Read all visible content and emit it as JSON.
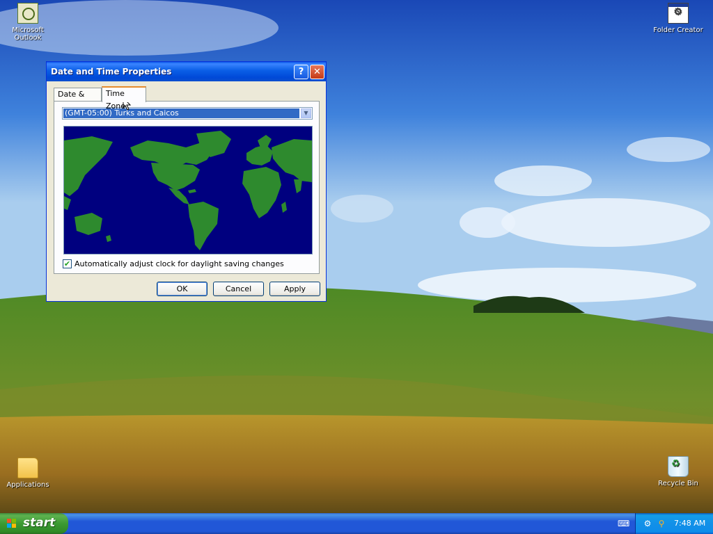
{
  "desktop": {
    "icons": [
      {
        "label": "Microsoft Outlook",
        "icon": "outlook-icon"
      },
      {
        "label": "Folder Creator",
        "icon": "folder-creator-icon"
      },
      {
        "label": "Applications",
        "icon": "folder-icon"
      },
      {
        "label": "Recycle Bin",
        "icon": "recycle-bin-icon"
      }
    ]
  },
  "dialog": {
    "title": "Date and Time Properties",
    "help_glyph": "?",
    "close_glyph": "✕",
    "tabs": [
      {
        "label": "Date & Time",
        "selected": false
      },
      {
        "label": "Time Zone",
        "selected": true
      }
    ],
    "timezone": {
      "selected": "(GMT-05:00) Turks and Caicos",
      "arrow_glyph": "▼"
    },
    "dst_checkbox": {
      "label": "Automatically adjust clock for daylight saving changes",
      "checked": true,
      "check_glyph": "✔"
    },
    "buttons": {
      "ok": "OK",
      "cancel": "Cancel",
      "apply": "Apply"
    },
    "colors": {
      "ocean": "#00007f",
      "land": "#2e8a2e",
      "titlebar": "#0a5ee6",
      "selection": "#316ac5"
    }
  },
  "taskbar": {
    "start_label": "start",
    "clock": "7:48 AM",
    "tray_icons": [
      "keyboard-icon",
      "network-icon",
      "search-icon"
    ]
  }
}
